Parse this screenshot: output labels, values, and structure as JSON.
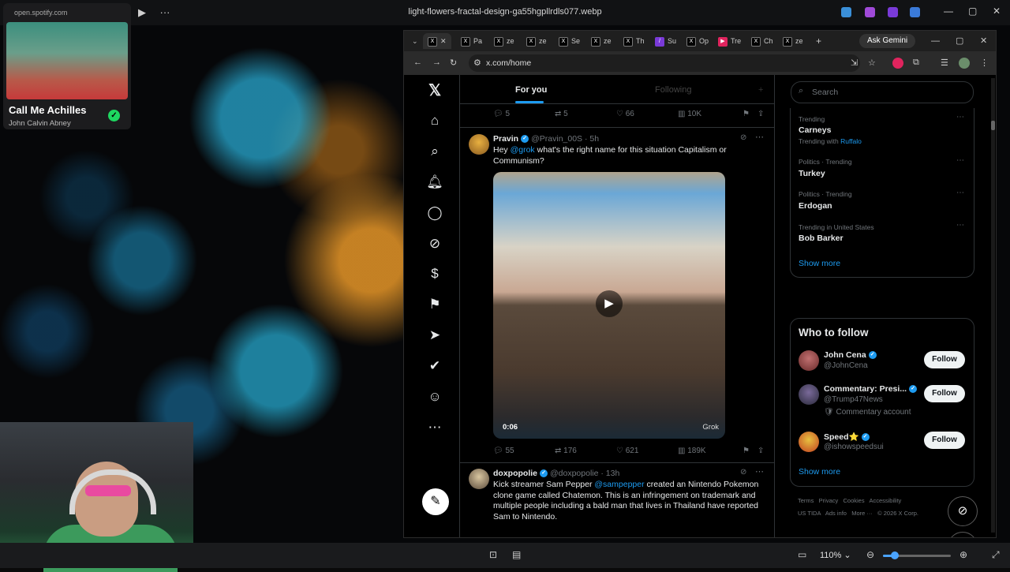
{
  "viewer": {
    "filename": "light-flowers-fractal-design-ga55hgpllrdls077.webp",
    "zoom": "110%",
    "zoom_level": 0.18
  },
  "spotify": {
    "url": "open.spotify.com",
    "track": "Call Me Achilles",
    "artist": "John Calvin Abney"
  },
  "browser": {
    "tabs": [
      "Pa",
      "ze",
      "ze",
      "Se",
      "ze",
      "Th",
      "Su",
      "Op",
      "Tre",
      "Ch",
      "ze"
    ],
    "ask_gemini": "Ask Gemini",
    "url": "x.com/home"
  },
  "x": {
    "tab_for_you": "For you",
    "tab_following": "Following",
    "top_actions": {
      "replies": "5",
      "reposts": "5",
      "likes": "66",
      "views": "10K"
    },
    "post1": {
      "name": "Pravin",
      "handle": "@Pravin_00S · 5h",
      "text_pre": "Hey ",
      "mention": "@grok",
      "text_post": " what's the right name for this situation Capitalism or Communism?",
      "video_time": "0:06",
      "watermark": "Grok",
      "replies": "55",
      "reposts": "176",
      "likes": "621",
      "views": "189K"
    },
    "post2": {
      "name": "doxpopolie",
      "handle": "@doxpopolie · 13h",
      "text_pre": "Kick streamer Sam Pepper ",
      "mention": "@sampepper",
      "text_post": " created an Nintendo Pokemon clone game called Chatemon. This is an infringement on trademark and multiple people including a bald man that lives in Thailand have reported Sam to Nintendo."
    },
    "search_placeholder": "Search",
    "trends": [
      {
        "meta": "Trending",
        "name": "Carneys",
        "sub_pre": "Trending with ",
        "sub_link": "Ruffalo"
      },
      {
        "meta": "Politics · Trending",
        "name": "Turkey"
      },
      {
        "meta": "Politics · Trending",
        "name": "Erdogan"
      },
      {
        "meta": "Trending in United States",
        "name": "Bob Barker"
      }
    ],
    "show_more": "Show more",
    "who_to_follow": "Who to follow",
    "follow_label": "Follow",
    "suggestions": [
      {
        "name": "John Cena",
        "handle": "@JohnCena",
        "note": ""
      },
      {
        "name": "Commentary: Presi...",
        "handle": "@Trump47News",
        "note": "Commentary account"
      },
      {
        "name": "Speed⭐",
        "handle": "@ishowspeedsui",
        "note": ""
      }
    ],
    "footer_line1": "Terms   Privacy   Cookies   Accessibility",
    "footer_line2": "US TIDA   Ads info   More ···   © 2026 X Corp."
  },
  "colors": {
    "accent": "#1d9bf0",
    "bg": "#000000",
    "muted": "#71767b"
  }
}
